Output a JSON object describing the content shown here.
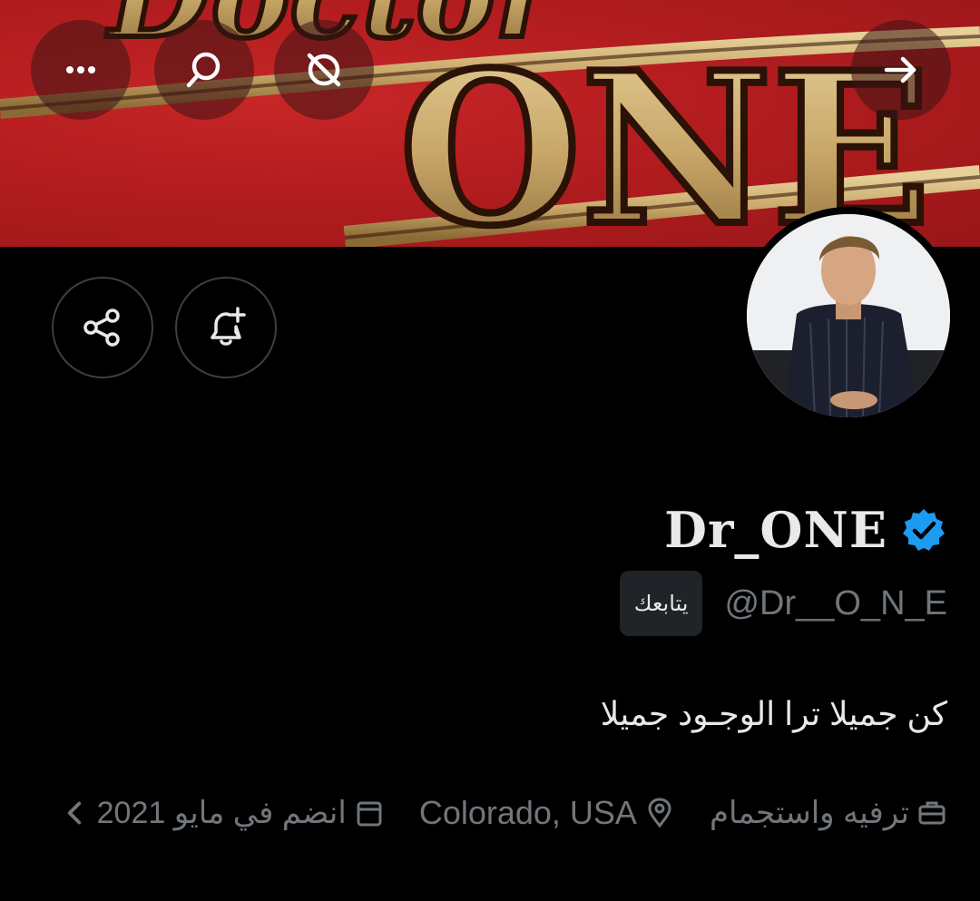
{
  "header": {
    "more_icon": "more-icon",
    "search_icon": "search-icon",
    "grok_icon": "grok-icon",
    "forward_icon": "arrow-right-icon"
  },
  "banner": {
    "logo_text_top": "Doctor",
    "logo_text_main": "ONE"
  },
  "profile": {
    "display_name": "Dr_ONE",
    "verified": true,
    "handle": "@Dr__O_N_E",
    "follows_you_label": "يتابعك",
    "bio": "كن جميلا ترا الوجـود جميلا"
  },
  "meta": {
    "category": "ترفيه واستجمام",
    "location": "Colorado, USA",
    "joined": "انضم في مايو 2021"
  },
  "colors": {
    "background": "#000000",
    "verified_blue": "#1d9bf0",
    "muted_text": "#71767b",
    "banner_red": "#c0221f",
    "banner_gold": "#c9a86a"
  }
}
